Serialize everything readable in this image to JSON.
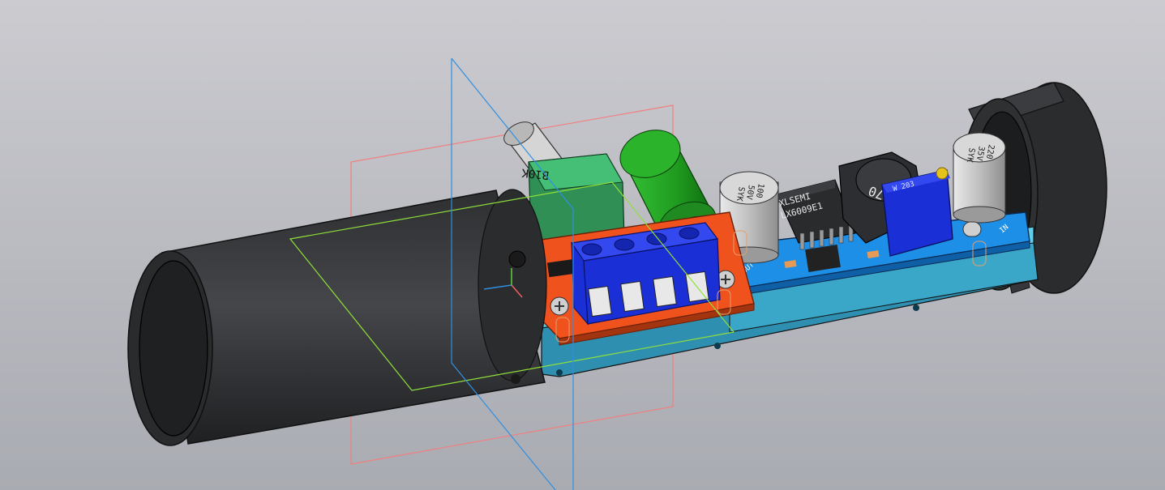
{
  "viewport": {
    "background_top": "#cbcbd0",
    "background_bottom": "#a9abb2"
  },
  "colors": {
    "tube": "#3a3b3e",
    "tube_dark": "#1f2022",
    "pcb_blue": "#1e8fe6",
    "pcb_orange": "#f0521e",
    "carrier_cyan": "#5ad0ee",
    "terminal_blue": "#1a2fd6",
    "pot_green": "#39b36a",
    "cap_green": "#1f9a1f",
    "plane_xy": "#f08080",
    "plane_xz": "#8fe03a",
    "plane_yz": "#2f8fe0"
  },
  "labels": {
    "potentiometer": "B10K",
    "cap_left_1": "100",
    "cap_left_2": "50V",
    "cap_left_3": "SYK",
    "chip_line1": "XLSEMI",
    "chip_line2": "LX6009E1",
    "inductor": "470",
    "trimmer": "W 203",
    "cap_right_1": "220",
    "cap_right_2": "35V",
    "cap_right_3": "SYK",
    "out_label": "OUT",
    "in_label": "IN"
  }
}
